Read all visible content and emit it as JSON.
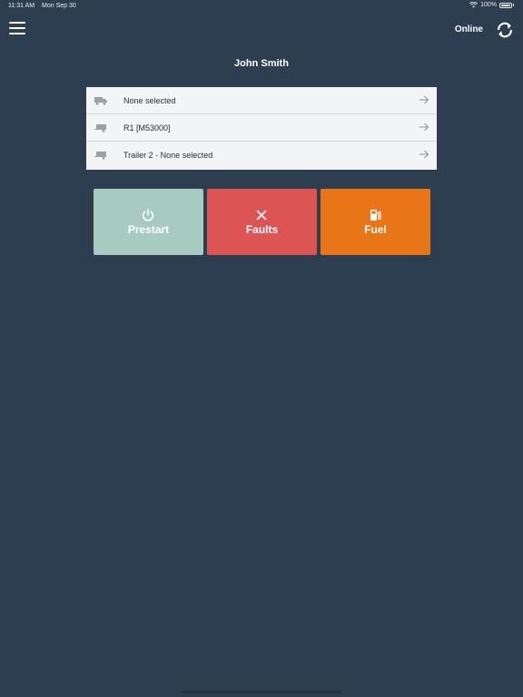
{
  "status_bar": {
    "time": "11:31 AM",
    "date": "Mon Sep 30",
    "battery": "100%",
    "wifi_icon": "wifi-icon",
    "battery_icon": "battery-icon"
  },
  "nav": {
    "menu_icon": "hamburger-menu-icon",
    "connection_status": "Online",
    "sync_icon": "sync-icon"
  },
  "driver": {
    "name": "John Smith"
  },
  "vehicles": [
    {
      "icon": "truck-icon",
      "label": "None selected",
      "action_icon": "arrow-right-icon"
    },
    {
      "icon": "trailer-icon",
      "label": "R1 [M53000]",
      "action_icon": "arrow-right-icon"
    },
    {
      "icon": "trailer-icon",
      "label": "Trailer 2 - None selected",
      "action_icon": "arrow-right-icon"
    }
  ],
  "actions": [
    {
      "icon": "power-icon",
      "label": "Prestart",
      "color": "#a7cbc1"
    },
    {
      "icon": "close-x-icon",
      "label": "Faults",
      "color": "#dc5454"
    },
    {
      "icon": "fuel-pump-icon",
      "label": "Fuel",
      "color": "#e87617"
    }
  ],
  "colors": {
    "background": "#2d3e50",
    "list_background": "#f3f4f6"
  }
}
